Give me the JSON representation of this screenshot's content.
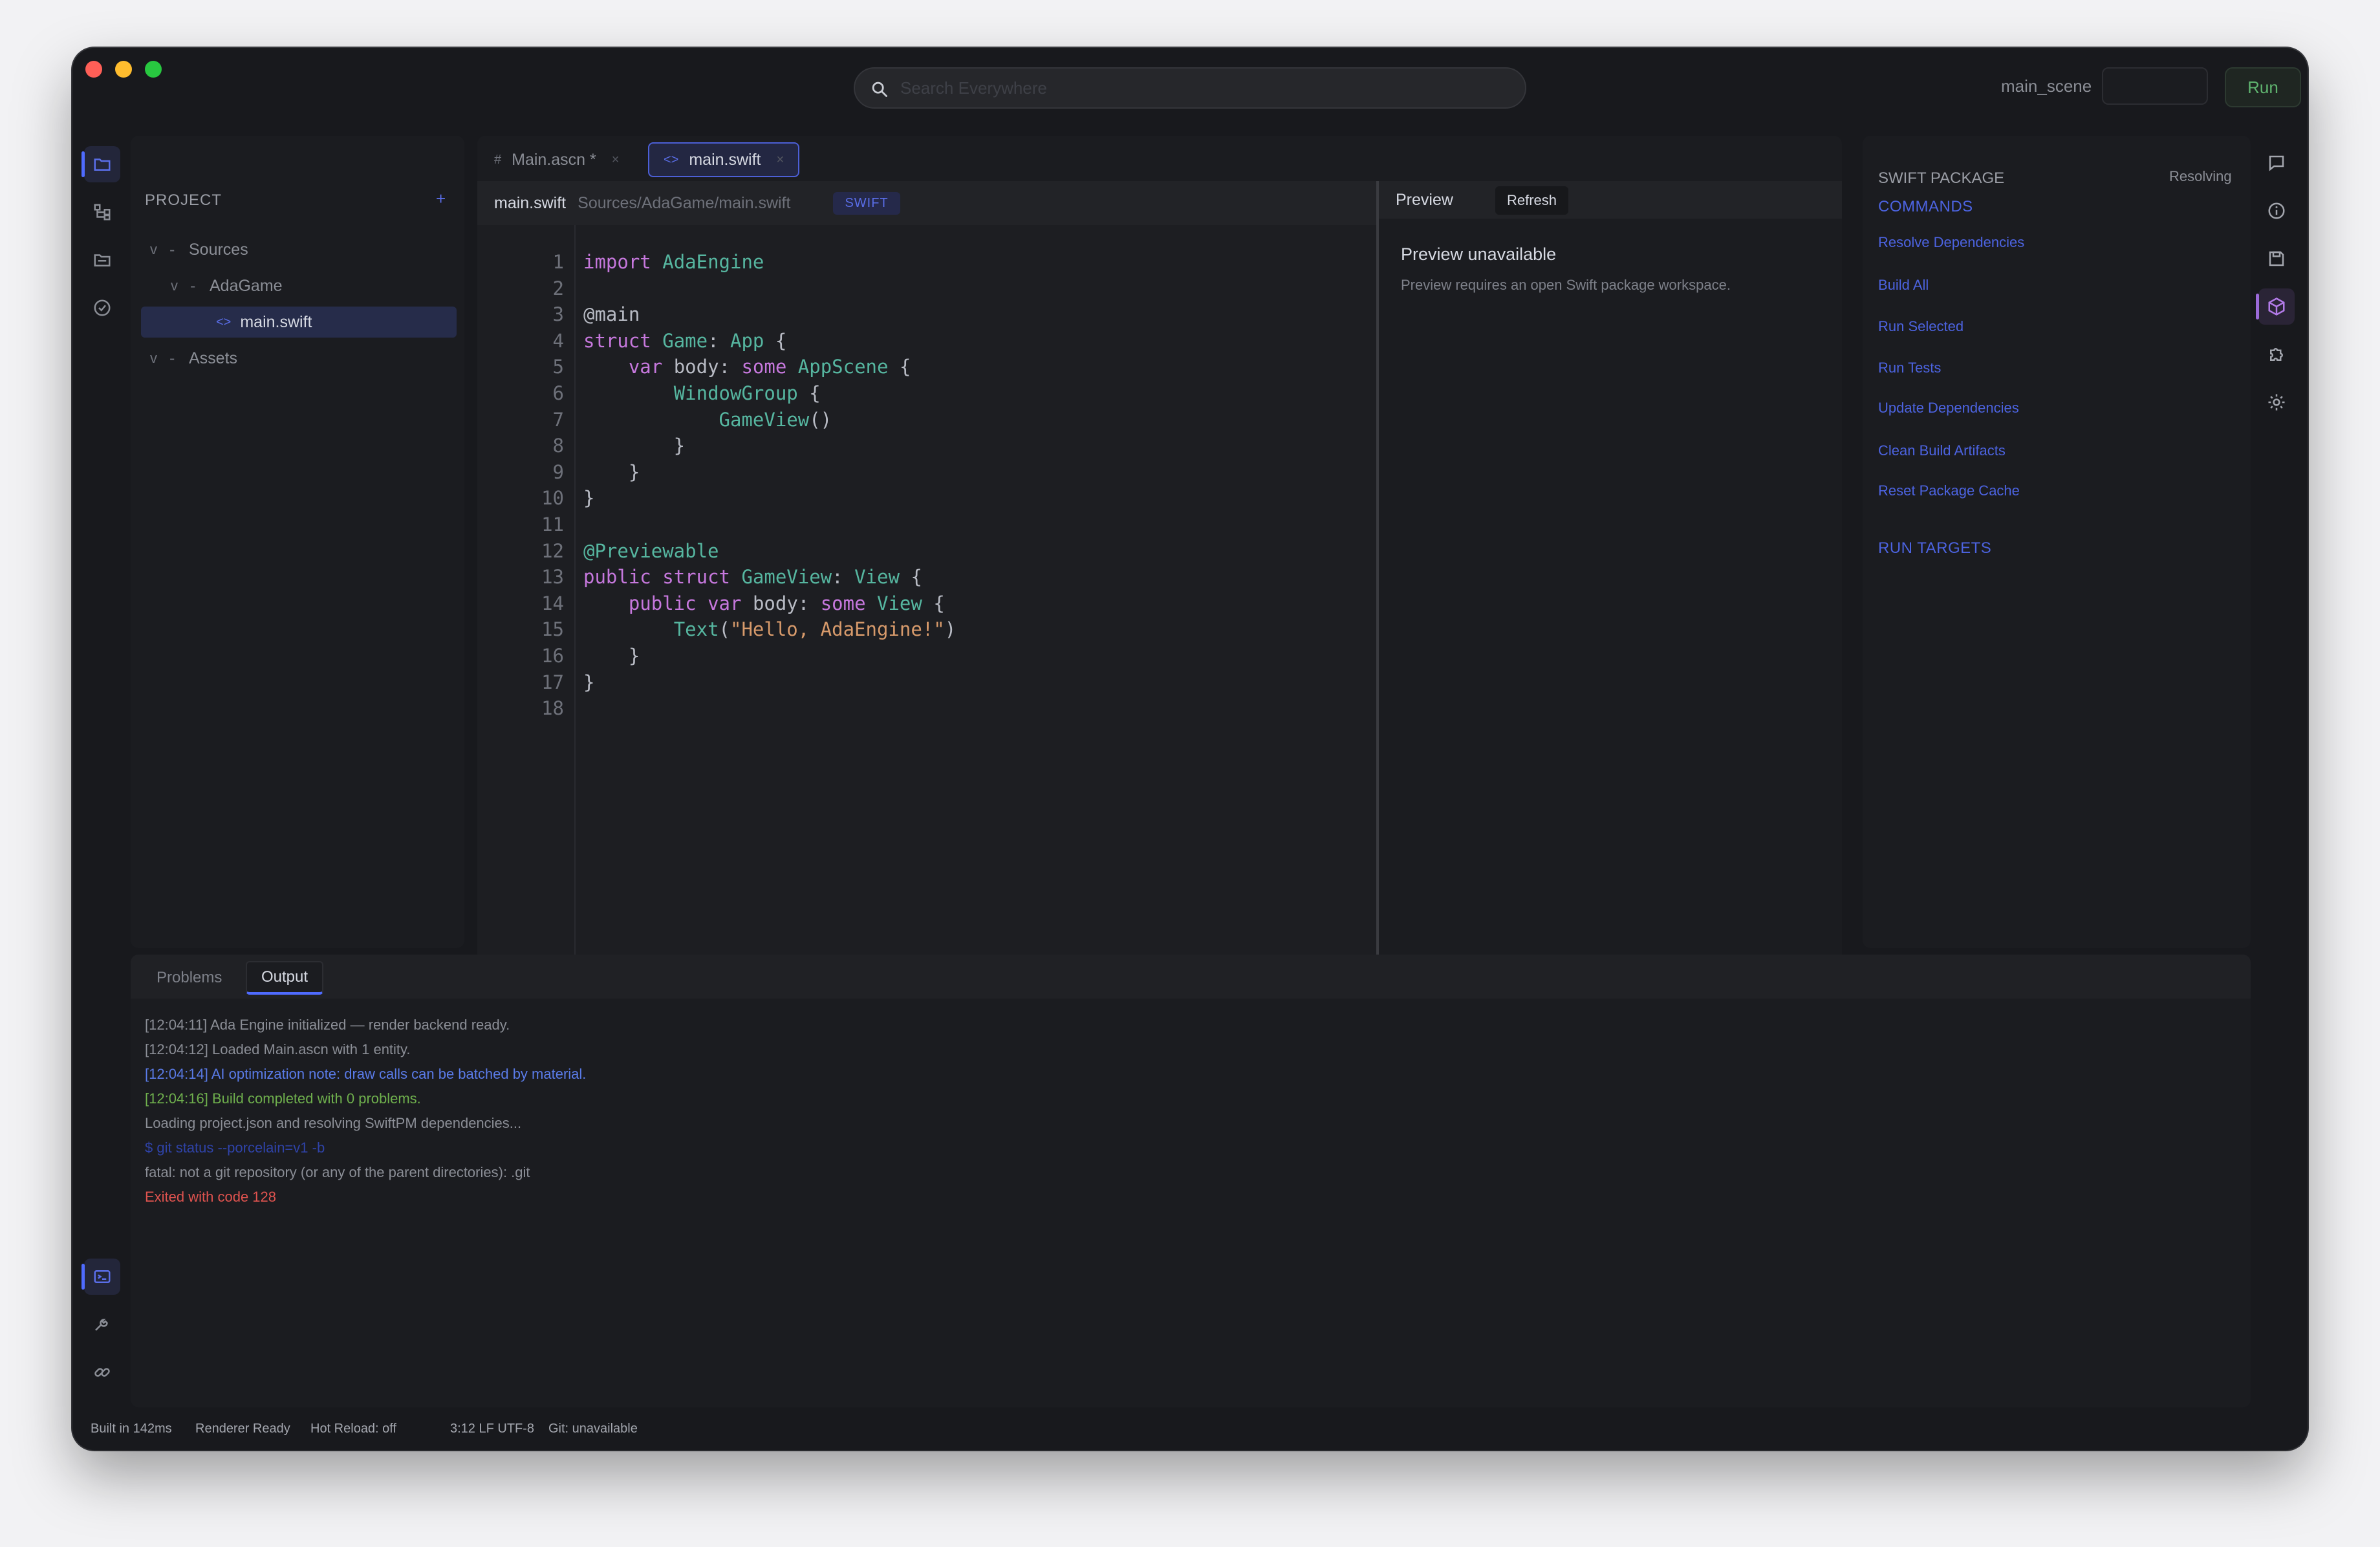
{
  "titlebar": {
    "search_placeholder": "Search Everywhere",
    "scene": "main_scene",
    "run_label": "Run"
  },
  "project": {
    "title": "PROJECT",
    "add": "+",
    "tree": [
      {
        "chev": "v",
        "dash": "-",
        "label": "Sources"
      },
      {
        "chev": "v",
        "dash": "-",
        "label": "AdaGame"
      },
      {
        "icon": "<>",
        "label": "main.swift"
      },
      {
        "chev": "v",
        "dash": "-",
        "label": "Assets"
      }
    ]
  },
  "tabs": [
    {
      "icon": "#",
      "label": "Main.ascn *",
      "close": "×"
    },
    {
      "icon": "<>",
      "label": "main.swift",
      "close": "×"
    }
  ],
  "editor": {
    "file": "main.swift",
    "path": "Sources/AdaGame/main.swift",
    "language": "SWIFT",
    "line_numbers": [
      "1",
      "2",
      "3",
      "4",
      "5",
      "6",
      "7",
      "8",
      "9",
      "10",
      "11",
      "12",
      "13",
      "14",
      "15",
      "16",
      "17",
      "18"
    ],
    "code": [
      "import AdaEngine",
      "",
      "@main",
      "struct Game: App {",
      "    var body: some AppScene {",
      "        WindowGroup {",
      "            GameView()",
      "        }",
      "    }",
      "}",
      "",
      "@Previewable",
      "public struct GameView: View {",
      "    public var body: some View {",
      "        Text(\"Hello, AdaEngine!\")",
      "    }",
      "}",
      ""
    ]
  },
  "preview": {
    "title": "Preview",
    "refresh": "Refresh",
    "heading": "Preview unavailable",
    "message": "Preview requires an open Swift package workspace."
  },
  "package": {
    "title": "SWIFT PACKAGE",
    "status": "Resolving",
    "commands_label": "COMMANDS",
    "commands": [
      "Resolve Dependencies",
      "Build All",
      "Run Selected",
      "Run Tests",
      "Update Dependencies",
      "Clean Build Artifacts",
      "Reset Package Cache"
    ],
    "targets_label": "RUN TARGETS"
  },
  "bottom": {
    "tabs": [
      "Problems",
      "Output"
    ],
    "logs": [
      "[12:04:11] Ada Engine initialized — render backend ready.",
      "[12:04:12] Loaded Main.ascn with 1 entity.",
      "[12:04:14] AI optimization note: draw calls can be batched by material.",
      "[12:04:16] Build completed with 0 problems.",
      "Loading project.json and resolving SwiftPM dependencies...",
      "$ git status --porcelain=v1 -b",
      "fatal: not a git repository (or any of the parent directories): .git",
      "Exited with code 128"
    ]
  },
  "statusbar": {
    "built": "Built in 142ms",
    "renderer": "Renderer Ready",
    "hot_reload": "Hot Reload: off",
    "cursor": "3:12 LF UTF-8",
    "git": "Git: unavailable"
  },
  "colors": {
    "accent": "#4f6bff",
    "success": "#6fb04d",
    "error": "#e0534f",
    "keyword": "#c678dd",
    "type": "#56b6a0",
    "string": "#d79a6b"
  }
}
